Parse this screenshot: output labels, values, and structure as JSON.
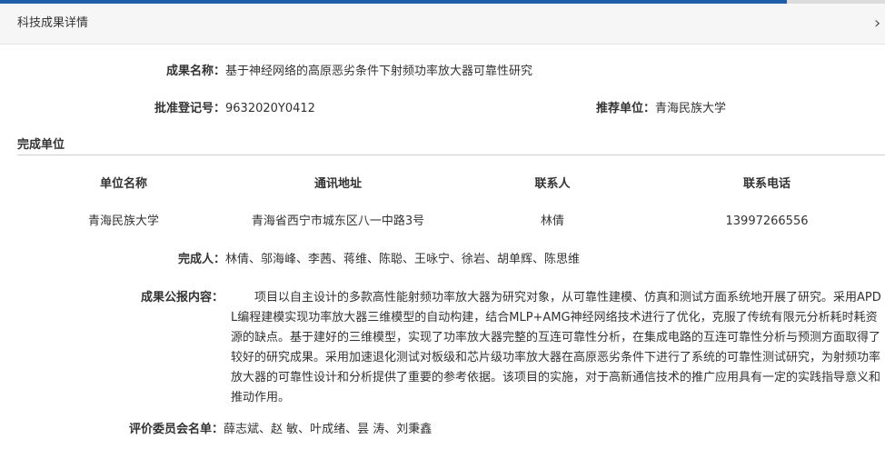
{
  "header": {
    "title": "科技成果详情",
    "close_glyph": "›"
  },
  "fields": {
    "name_label": "成果名称：",
    "name_value": "基于神经网络的高原恶劣条件下射频功率放大器可靠性研究",
    "reg_label": "批准登记号：",
    "reg_value": "9632020Y0412",
    "recommend_label": "推荐单位：",
    "recommend_value": "青海民族大学"
  },
  "units_section": {
    "title": "完成单位",
    "columns": [
      "单位名称",
      "通讯地址",
      "联系人",
      "联系电话"
    ],
    "rows": [
      [
        "青海民族大学",
        "青海省西宁市城东区八一中路3号",
        "林倩",
        "13997266556"
      ]
    ]
  },
  "people": {
    "label": "完成人：",
    "value": "林倩、邬海峰、李茜、蒋维、陈聪、王咏宁、徐岩、胡单辉、陈思维"
  },
  "summary": {
    "label": "成果公报内容：",
    "text": "项目以自主设计的多款高性能射频功率放大器为研究对象，从可靠性建模、仿真和测试方面系统地开展了研究。采用APDL编程建模实现功率放大器三维模型的自动构建，结合MLP+AMG神经网络技术进行了优化，克服了传统有限元分析耗时耗资源的缺点。基于建好的三维模型，实现了功率放大器完整的互连可靠性分析，在集成电路的互连可靠性分析与预测方面取得了较好的研究成果。采用加速退化测试对板级和芯片级功率放大器在高原恶劣条件下进行了系统的可靠性测试研究，为射频功率放大器的可靠性设计和分析提供了重要的参考依据。该项目的实施，对于高新通信技术的推广应用具有一定的实践指导意义和推动作用。"
  },
  "committee": {
    "label": "评价委员会名单：",
    "value": "薛志斌、赵 敏、叶成绪、昙 涛、刘秉鑫"
  },
  "colors": {
    "accent": "#1f5fa8",
    "text": "#333333",
    "header_bg": "#f6f6f6"
  }
}
